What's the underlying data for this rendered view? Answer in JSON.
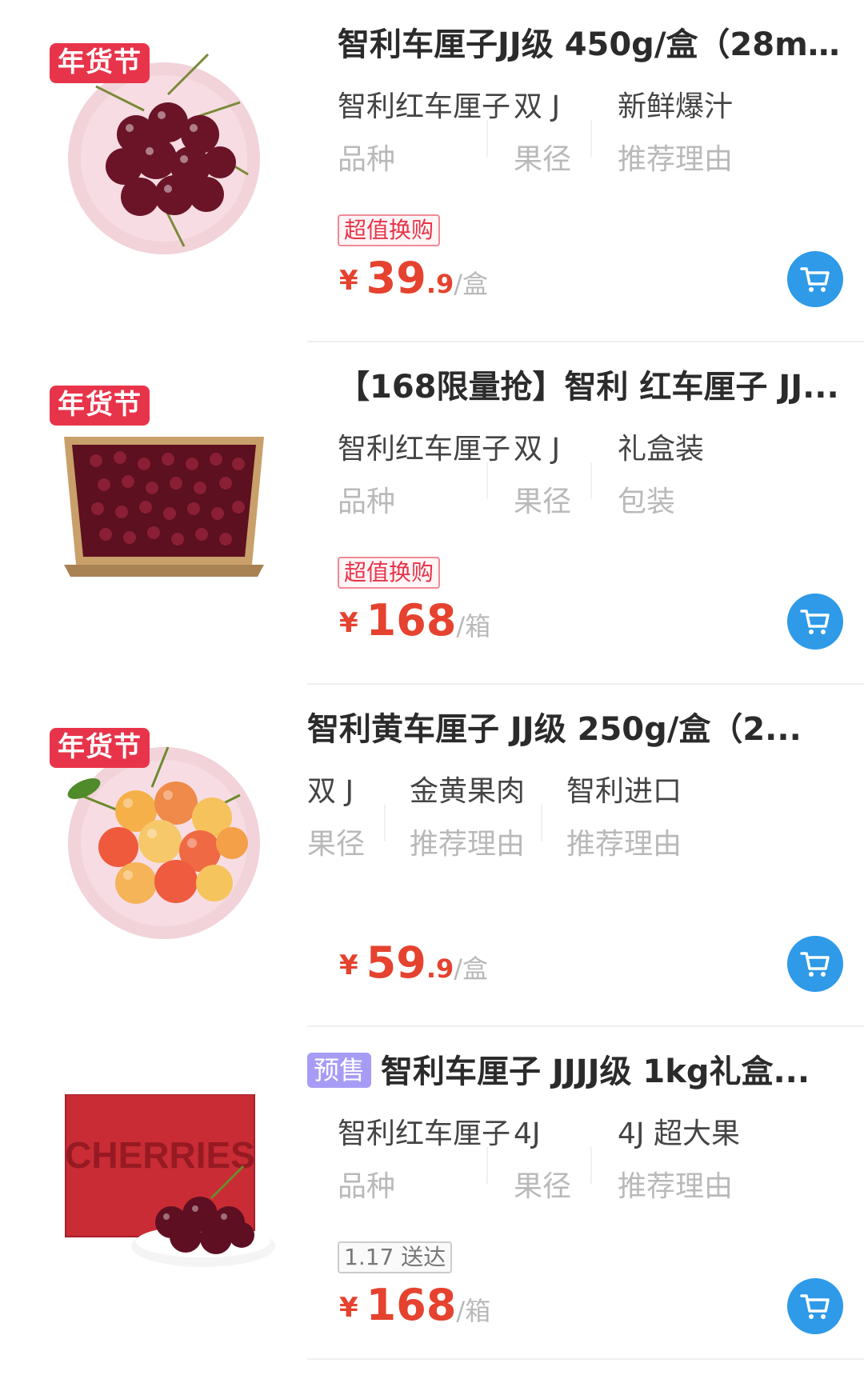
{
  "products": [
    {
      "promo": "年货节",
      "title": "智利车厘子JJ级 450g/盒（28m...",
      "presale": "",
      "attrs": [
        {
          "value": "智利红车厘子",
          "key": "品种"
        },
        {
          "value": "双 J",
          "key": "果径"
        },
        {
          "value": "新鲜爆汁",
          "key": "推荐理由"
        }
      ],
      "tag": "超值换购",
      "tag_style": "red",
      "price": {
        "currency": "¥",
        "int": "39",
        "dec": ".9",
        "unit": "/盒"
      },
      "image": "cherries-in-pink-bowl"
    },
    {
      "promo": "年货节",
      "title": "【168限量抢】智利 红车厘子 JJ...",
      "presale": "",
      "attrs": [
        {
          "value": "智利红车厘子",
          "key": "品种"
        },
        {
          "value": "双 J",
          "key": "果径"
        },
        {
          "value": "礼盒装",
          "key": "包装"
        }
      ],
      "tag": "超值换购",
      "tag_style": "red",
      "price": {
        "currency": "¥",
        "int": "168",
        "dec": "",
        "unit": "/箱"
      },
      "image": "cherries-in-carton-box"
    },
    {
      "promo": "年货节",
      "title": "智利黄车厘子 JJ级 250g/盒（2...",
      "presale": "",
      "attrs": [
        {
          "value": "双 J",
          "key": "果径"
        },
        {
          "value": "金黄果肉",
          "key": "推荐理由"
        },
        {
          "value": "智利进口",
          "key": "推荐理由"
        }
      ],
      "tag": "",
      "tag_style": "",
      "price": {
        "currency": "¥",
        "int": "59",
        "dec": ".9",
        "unit": "/盒"
      },
      "image": "yellow-cherries-in-bowl"
    },
    {
      "promo": "",
      "title": "智利车厘子 JJJJ级 1kg礼盒...",
      "presale": "预售",
      "attrs": [
        {
          "value": "智利红车厘子",
          "key": "品种"
        },
        {
          "value": "4J",
          "key": "果径"
        },
        {
          "value": "4J 超大果",
          "key": "推荐理由"
        }
      ],
      "tag": "1.17 送达",
      "tag_style": "gray",
      "price": {
        "currency": "¥",
        "int": "168",
        "dec": "",
        "unit": "/箱"
      },
      "image": "cherries-gift-box",
      "box_text": "CHERRIES"
    }
  ],
  "colors": {
    "price": "#e5422f",
    "promo_badge": "#e8344a",
    "cart_button": "#2e9ae8",
    "presale_badge": "#a79cf5"
  },
  "icons": {
    "cart": "shopping-cart-icon"
  }
}
